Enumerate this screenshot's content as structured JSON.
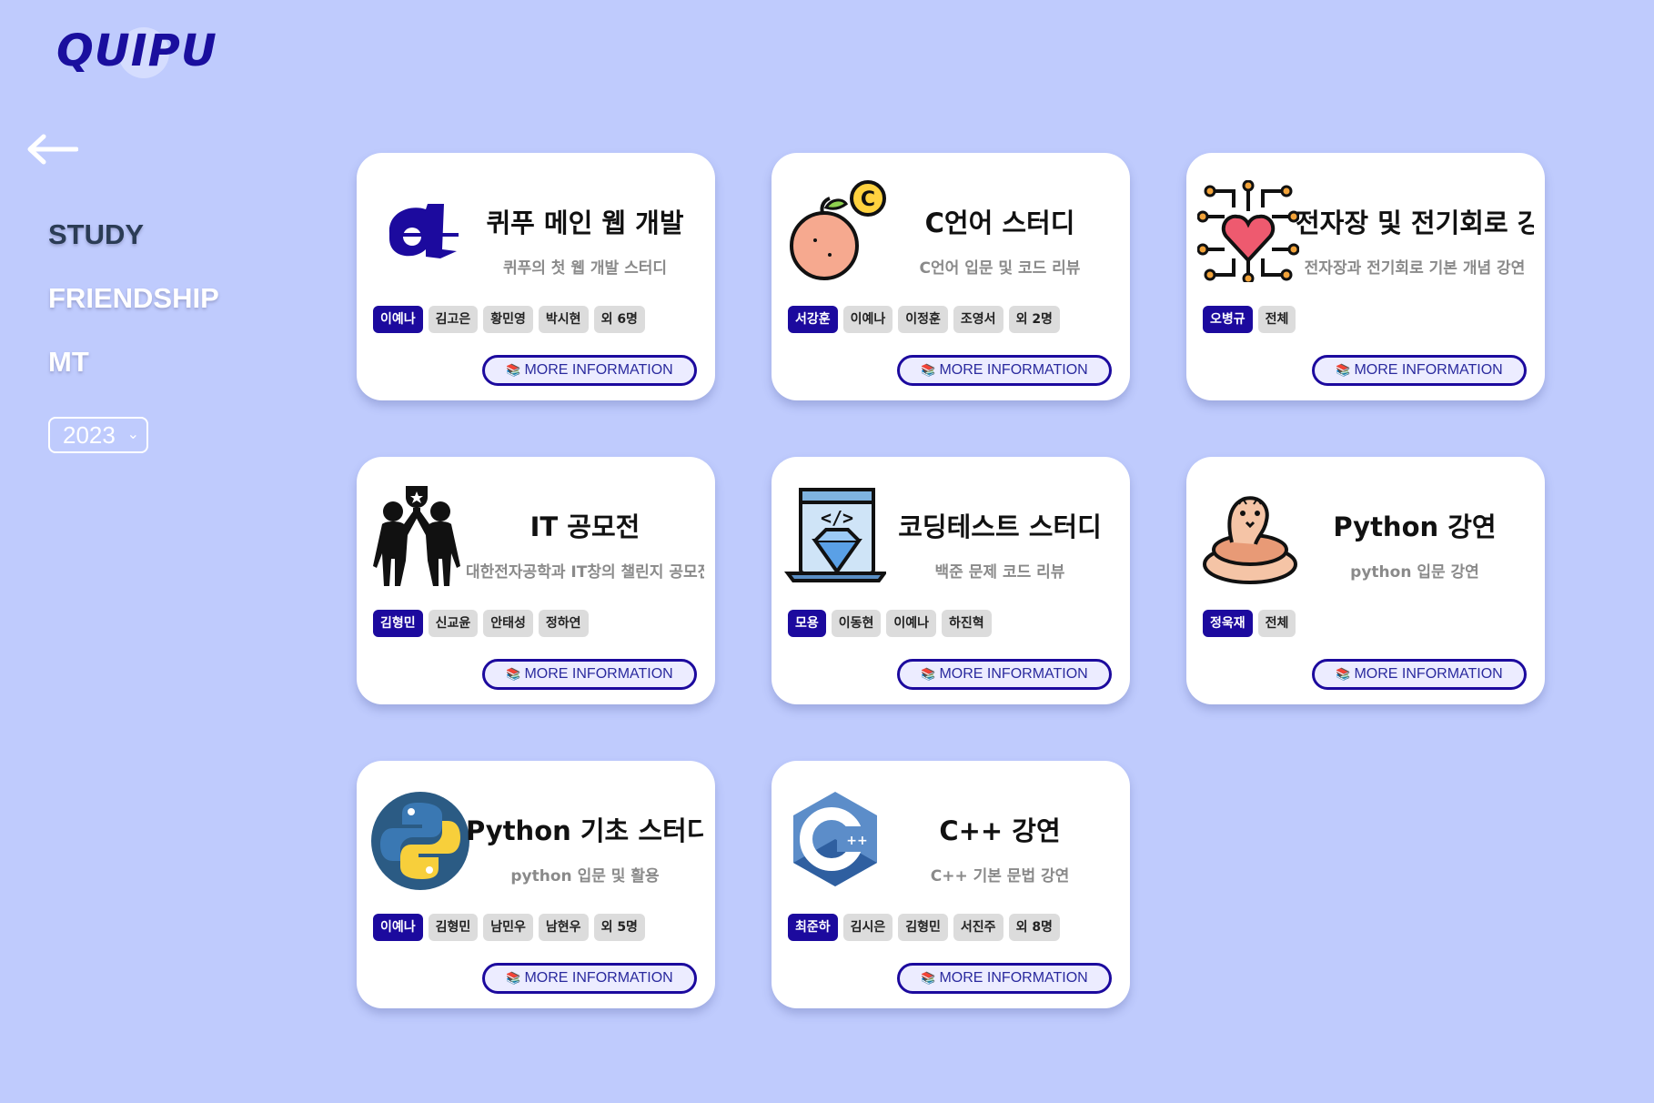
{
  "brand": {
    "logo_text": "QUIPU"
  },
  "nav": {
    "back_icon": "arrow-left-icon",
    "items": [
      {
        "label": "STUDY",
        "active": true
      },
      {
        "label": "FRIENDSHIP",
        "active": false
      },
      {
        "label": "MT",
        "active": false
      }
    ],
    "year_select": {
      "value": "2023"
    }
  },
  "more_label": "MORE INFORMATION",
  "more_icon": "books-icon",
  "cards": [
    {
      "title": "퀴푸 메인 웹 개발",
      "desc": "퀴푸의 첫 웹 개발 스터디",
      "icon": "quipu-logo-icon",
      "tags": [
        "이예나",
        "김고은",
        "황민영",
        "박시현",
        "외 6명"
      ]
    },
    {
      "title": "C언어 스터디",
      "desc": "C언어 입문 및 코드 리뷰",
      "icon": "orange-c-icon",
      "tags": [
        "서강훈",
        "이예나",
        "이정훈",
        "조영서",
        "외 2명"
      ]
    },
    {
      "title": "전자장 및 전기회로 강연",
      "desc": "전자장과 전기회로 기본 개념 강연",
      "icon": "circuit-heart-icon",
      "tags": [
        "오병규",
        "전체"
      ]
    },
    {
      "title": "IT 공모전",
      "desc": "대한전자공학과 IT창의 챌린지 공모전",
      "icon": "trophy-team-icon",
      "tags": [
        "김형민",
        "신교윤",
        "안태성",
        "정하연"
      ]
    },
    {
      "title": "코딩테스트 스터디",
      "desc": "백준 문제 코드 리뷰",
      "icon": "laptop-code-icon",
      "tags": [
        "모용",
        "이동현",
        "이예나",
        "하진혁"
      ]
    },
    {
      "title": "Python 강연",
      "desc": "python 입문 강연",
      "icon": "snake-icon",
      "tags": [
        "정욱재",
        "전체"
      ]
    },
    {
      "title": "Python 기초 스터디",
      "desc": "python 입문 및 활용",
      "icon": "python-logo-icon",
      "tags": [
        "이예나",
        "김형민",
        "남민우",
        "남현우",
        "외 5명"
      ]
    },
    {
      "title": "C++ 강연",
      "desc": "C++ 기본 문법 강연",
      "icon": "cpp-logo-icon",
      "tags": [
        "최준하",
        "김시은",
        "김형민",
        "서진주",
        "외 8명"
      ]
    }
  ]
}
